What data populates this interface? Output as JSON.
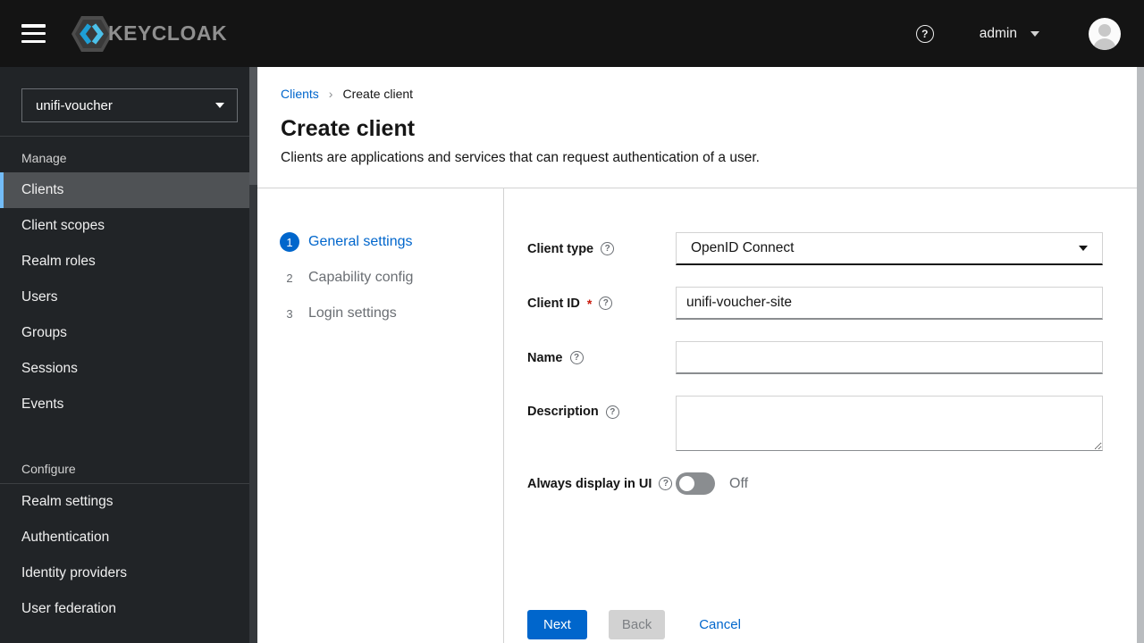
{
  "masthead": {
    "brand": "KEYCLOAK",
    "username": "admin"
  },
  "icons": {
    "help_glyph": "?",
    "breadcrumb_sep": "›"
  },
  "sidebar": {
    "realm_selector": {
      "value": "unifi-voucher"
    },
    "sections": [
      {
        "title": "Manage",
        "items": [
          {
            "label": "Clients",
            "selected": true
          },
          {
            "label": "Client scopes",
            "selected": false
          },
          {
            "label": "Realm roles",
            "selected": false
          },
          {
            "label": "Users",
            "selected": false
          },
          {
            "label": "Groups",
            "selected": false
          },
          {
            "label": "Sessions",
            "selected": false
          },
          {
            "label": "Events",
            "selected": false
          }
        ]
      },
      {
        "title": "Configure",
        "items": [
          {
            "label": "Realm settings",
            "selected": false
          },
          {
            "label": "Authentication",
            "selected": false
          },
          {
            "label": "Identity providers",
            "selected": false
          },
          {
            "label": "User federation",
            "selected": false
          }
        ]
      }
    ]
  },
  "breadcrumb": {
    "parent": "Clients",
    "current": "Create client"
  },
  "page": {
    "title": "Create client",
    "subtitle": "Clients are applications and services that can request authentication of a user."
  },
  "wizard": {
    "steps": [
      {
        "number": "1",
        "label": "General settings",
        "active": true
      },
      {
        "number": "2",
        "label": "Capability config",
        "active": false
      },
      {
        "number": "3",
        "label": "Login settings",
        "active": false
      }
    ]
  },
  "form": {
    "client_type": {
      "label": "Client type",
      "value": "OpenID Connect"
    },
    "client_id": {
      "label": "Client ID",
      "required_marker": "*",
      "value": "unifi-voucher-site"
    },
    "name": {
      "label": "Name",
      "value": ""
    },
    "description": {
      "label": "Description",
      "value": ""
    },
    "always_display": {
      "label": "Always display in UI",
      "state_label": "Off"
    }
  },
  "footer": {
    "next": "Next",
    "back": "Back",
    "cancel": "Cancel"
  },
  "colors": {
    "accent": "#0066cc",
    "masthead_bg": "#141414",
    "sidebar_bg": "#212427",
    "nav_selected_bg": "#4f5255",
    "nav_selected_border": "#73bcf7",
    "required": "#c9190b",
    "divider": "#d2d2d2"
  }
}
